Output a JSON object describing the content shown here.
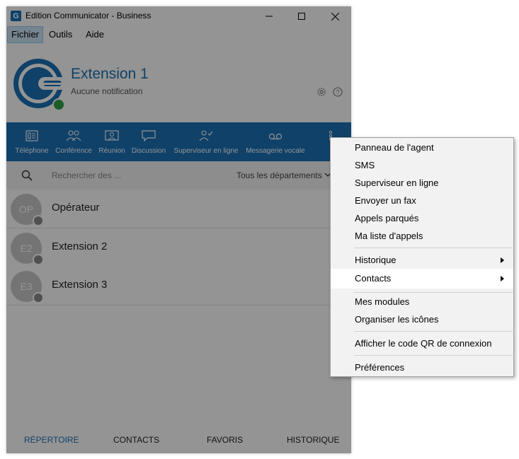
{
  "window": {
    "title": "Edition Communicator - Business",
    "logo_letter": "G"
  },
  "menubar": {
    "items": [
      {
        "label": "Fichier"
      },
      {
        "label": "Outils"
      },
      {
        "label": "Aide"
      }
    ]
  },
  "profile": {
    "name": "Extension 1",
    "status": "Aucune notification",
    "presence_color": "#2ea043"
  },
  "toolbar": {
    "items": [
      {
        "label": "Téléphone",
        "icon": "phone-icon"
      },
      {
        "label": "Conférence",
        "icon": "conference-icon"
      },
      {
        "label": "Réunion",
        "icon": "meeting-icon"
      },
      {
        "label": "Discussion",
        "icon": "chat-icon"
      },
      {
        "label": "Superviseur en ligne",
        "icon": "supervisor-icon"
      },
      {
        "label": "Messagerie vocale",
        "icon": "voicemail-icon"
      }
    ]
  },
  "search": {
    "placeholder": "Rechercher des ...",
    "department": "Tous les départements"
  },
  "contacts": [
    {
      "initials": "OP",
      "name": "Opérateur"
    },
    {
      "initials": "E2",
      "name": "Extension 2"
    },
    {
      "initials": "E3",
      "name": "Extension 3"
    }
  ],
  "bottom_tabs": [
    {
      "label": "RÉPERTOIRE",
      "active": true
    },
    {
      "label": "CONTACTS",
      "active": false
    },
    {
      "label": "FAVORIS",
      "active": false
    },
    {
      "label": "HISTORIQUE",
      "active": false
    }
  ],
  "context_menu": {
    "group1": [
      {
        "label": "Panneau de l'agent"
      },
      {
        "label": "SMS"
      },
      {
        "label": "Superviseur en ligne"
      },
      {
        "label": "Envoyer un fax"
      },
      {
        "label": "Appels parqués"
      },
      {
        "label": "Ma liste d'appels"
      }
    ],
    "group2": [
      {
        "label": "Historique",
        "submenu": true
      },
      {
        "label": "Contacts",
        "submenu": true,
        "highlighted": true
      }
    ],
    "group3": [
      {
        "label": "Mes modules"
      },
      {
        "label": "Organiser les icônes"
      }
    ],
    "group4": [
      {
        "label": "Afficher le code QR de connexion"
      }
    ],
    "group5": [
      {
        "label": "Préférences"
      }
    ]
  },
  "colors": {
    "brand": "#1b71b6",
    "overlay": "rgba(0,0,0,0.42)"
  }
}
